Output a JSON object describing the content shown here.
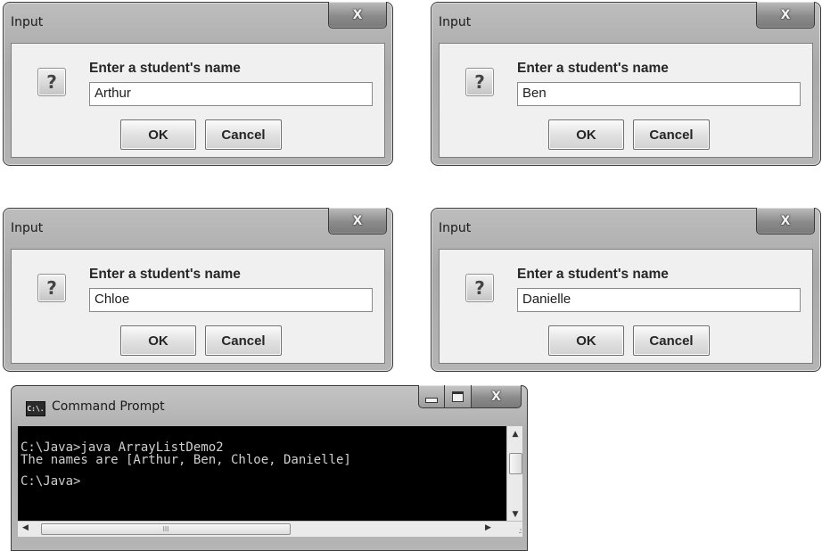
{
  "dialogs": [
    {
      "title": "Input",
      "close_icon": "X",
      "question_icon": "?",
      "prompt": "Enter a student's name",
      "value": "Arthur",
      "ok_label": "OK",
      "cancel_label": "Cancel"
    },
    {
      "title": "Input",
      "close_icon": "X",
      "question_icon": "?",
      "prompt": "Enter a student's name",
      "value": "Ben",
      "ok_label": "OK",
      "cancel_label": "Cancel"
    },
    {
      "title": "Input",
      "close_icon": "X",
      "question_icon": "?",
      "prompt": "Enter a student's name",
      "value": "Chloe",
      "ok_label": "OK",
      "cancel_label": "Cancel"
    },
    {
      "title": "Input",
      "close_icon": "X",
      "question_icon": "?",
      "prompt": "Enter a student's name",
      "value": "Danielle",
      "ok_label": "OK",
      "cancel_label": "Cancel"
    }
  ],
  "cmd": {
    "title": "Command Prompt",
    "app_icon": "C:\\.",
    "close_icon": "X",
    "lines": [
      "C:\\Java>java ArrayListDemo2",
      "The names are [Arthur, Ben, Chloe, Danielle]",
      "C:\\Java>"
    ],
    "scroll_up": "▲",
    "scroll_down": "▼",
    "scroll_left": "◀",
    "scroll_right": "▶",
    "thumb_grip": "III",
    "resize_grip": ".::"
  },
  "colors": {
    "console_bg": "#000000",
    "console_text": "#cfcfcf",
    "dialog_body": "#f0f0f0",
    "frame": "#b0b0b0"
  }
}
